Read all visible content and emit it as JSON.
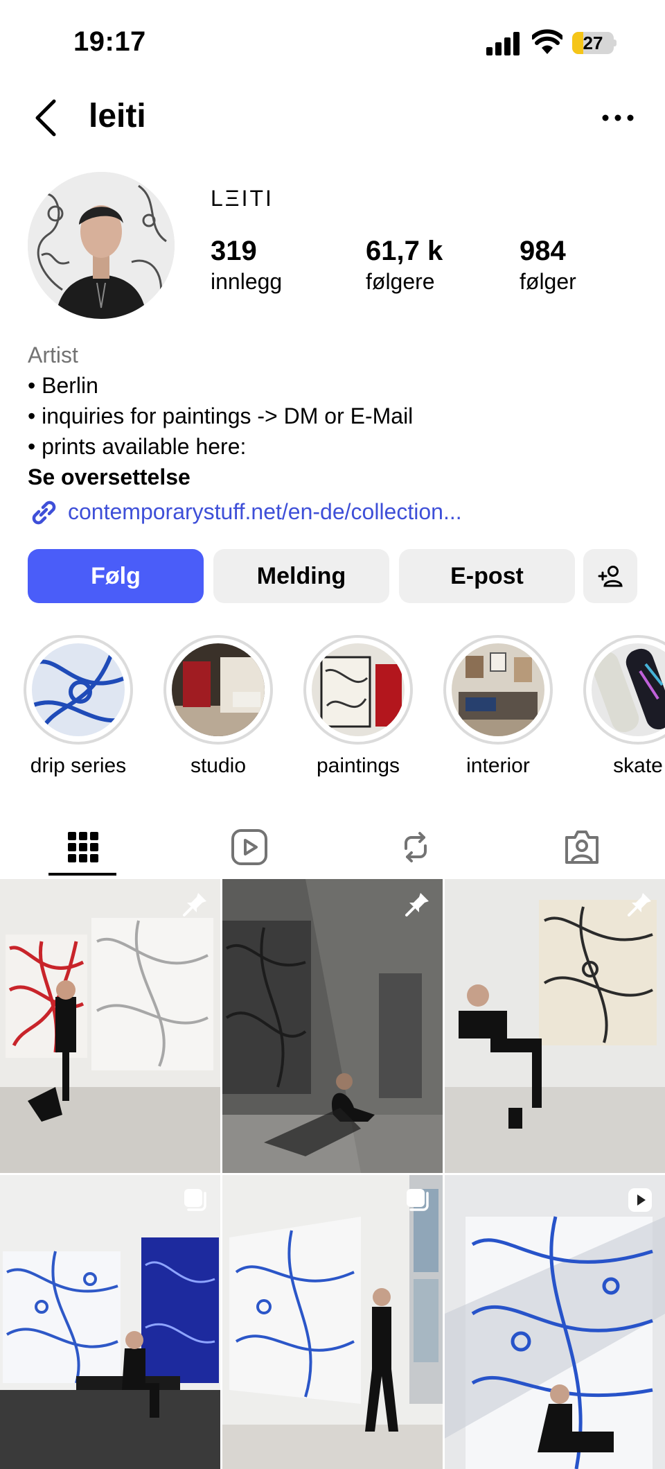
{
  "status_bar": {
    "time": "19:17",
    "battery": "27",
    "battery_level": 0.27
  },
  "header": {
    "handle": "leiti"
  },
  "profile": {
    "display_name": "LΞITI",
    "stats": [
      {
        "value": "319",
        "label": "innlegg"
      },
      {
        "value": "61,7 k",
        "label": "følgere"
      },
      {
        "value": "984",
        "label": "følger"
      }
    ],
    "bio": {
      "category": "Artist",
      "lines": [
        "• Berlin",
        "• inquiries for paintings -> DM or E-Mail",
        "• prints available here:"
      ],
      "translate": "Se oversettelse",
      "link": "contemporarystuff.net/en-de/collection..."
    }
  },
  "actions": {
    "follow": "Følg",
    "message": "Melding",
    "email": "E-post"
  },
  "highlights": [
    {
      "label": "drip series"
    },
    {
      "label": "studio"
    },
    {
      "label": "paintings"
    },
    {
      "label": "interior"
    },
    {
      "label": "skate"
    }
  ],
  "tabs": [
    "grid-icon",
    "reels-icon",
    "reposts-icon",
    "tagged-icon"
  ],
  "posts": [
    {
      "badge": "pin-icon"
    },
    {
      "badge": "pin-icon"
    },
    {
      "badge": "pin-icon"
    },
    {
      "badge": "carousel-icon"
    },
    {
      "badge": "carousel-icon"
    },
    {
      "badge": "reel-icon"
    }
  ],
  "colors": {
    "accent": "#4a5df9",
    "link": "#3e4fd8",
    "secondary_text": "#737373",
    "button_bg": "#efefef"
  }
}
